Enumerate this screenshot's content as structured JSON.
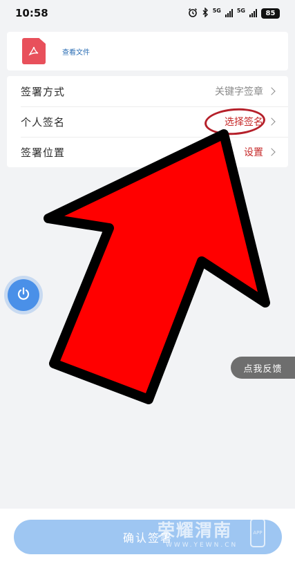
{
  "status_bar": {
    "time": "10:58",
    "net_1": "5G",
    "net_2": "5G",
    "battery": "85"
  },
  "file": {
    "icon": "pdf-file-icon",
    "link_label": "查看文件"
  },
  "settings": {
    "rows": [
      {
        "label": "签署方式",
        "value": "关键字签章"
      },
      {
        "label": "个人签名",
        "value": "选择签名"
      },
      {
        "label": "签署位置",
        "value": "设置"
      }
    ]
  },
  "feedback": {
    "label": "点我反馈"
  },
  "footer": {
    "confirm_label": "确认签署"
  },
  "watermark": {
    "title": "荣耀渭南",
    "site": "WWW.YEWN.CN",
    "app": "APP"
  },
  "colors": {
    "accent_blue": "#4a90e8",
    "confirm_button": "#9ec6f2",
    "highlight_red": "#c62828",
    "annotation_arrow": "#ff0000",
    "pdf_icon": "#e8505b"
  }
}
